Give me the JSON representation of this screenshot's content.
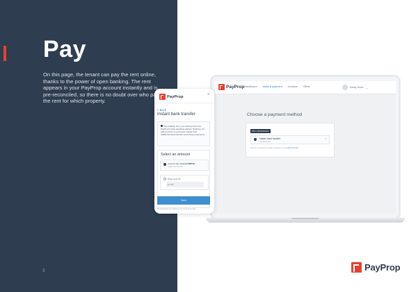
{
  "slide": {
    "title": "Pay",
    "description": "On this page, the tenant can pay the rent online, thanks to the power of open banking. The rent appears in your PayProp account instantly and is pre-reconciled, so there is no doubt over who paid the rent for which property.",
    "page_number": "3",
    "brand": "PayProp"
  },
  "laptop": {
    "logo": "PayProp",
    "nav": [
      "Dashboard",
      "Make a payment",
      "Invoices",
      "Offers"
    ],
    "user": "Kathy Kean",
    "heading": "Choose a payment method",
    "badge": "RECOMMENDED",
    "option_title": "Instant bank transfer",
    "option_sub": "No extra fees",
    "note_prefix": "We are secured by being a transfer to our ",
    "note_link": "bank account"
  },
  "phone": {
    "logo": "PayProp",
    "close": "×",
    "back": "< Back",
    "title": "Instant bank transfer",
    "info": "Pay instantly from your bank account via PayProp's bank operating partner. PayProp. It's safe and has no extra fees. Faster than traditional bank transfers and cheque payments.",
    "section": "Select an amount",
    "amount_due_label": "Amount due (total)",
    "amount_due_value": "£1 808.33",
    "amount_due_sub": "Latest rent invoice",
    "other_label": "Other amount",
    "other_value": "£  0.00",
    "button": "Next",
    "footer": "By proceeding you agree to our terms of service"
  },
  "colors": {
    "panel": "#2e3d4f",
    "accent": "#e8402d",
    "link": "#2f7fd1",
    "button": "#3e8ed0"
  }
}
